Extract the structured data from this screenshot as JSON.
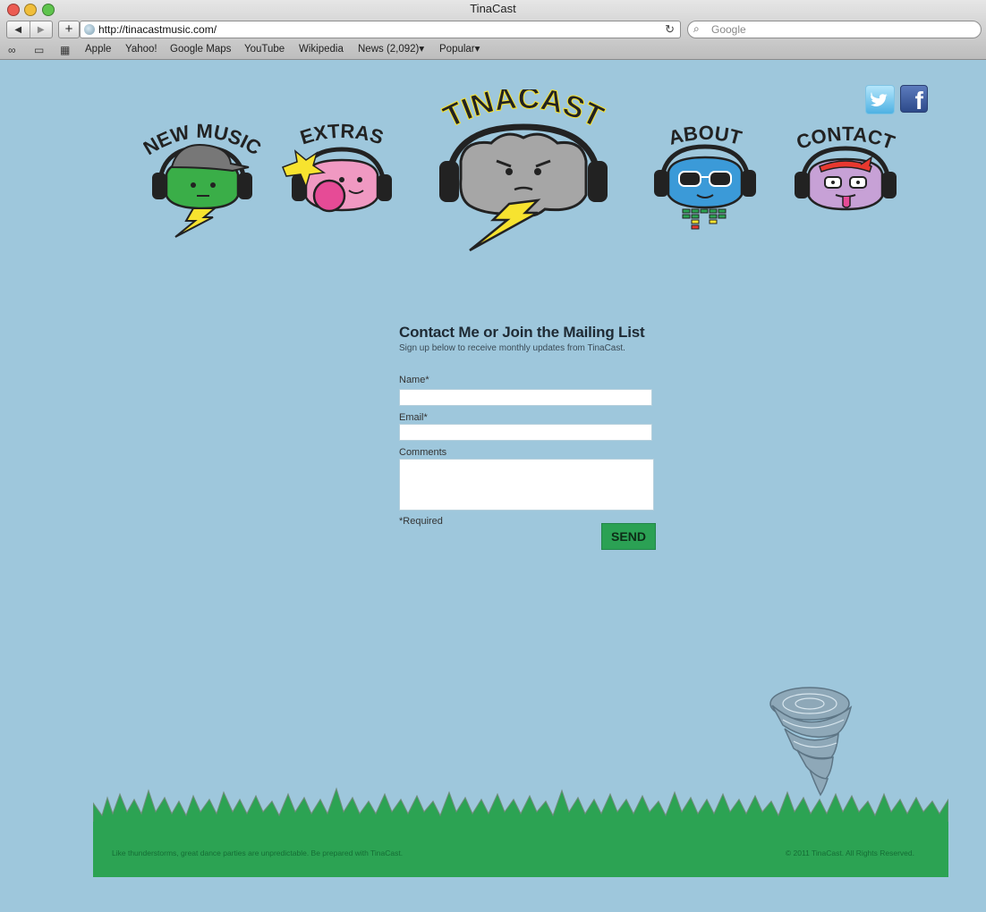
{
  "browser": {
    "title": "TinaCast",
    "url": "http://tinacastmusic.com/",
    "search_placeholder": "Google",
    "bookmarks": [
      "Apple",
      "Yahoo!",
      "Google Maps",
      "YouTube",
      "Wikipedia",
      "News (2,092)▾",
      "Popular▾"
    ]
  },
  "nav": {
    "new_music": "NEW MUSIC",
    "extras": "EXTRAS",
    "logo": "TINACAST",
    "about": "ABOUT",
    "contact": "CONTACT"
  },
  "social": {
    "facebook_glyph": "f"
  },
  "form": {
    "title": "Contact Me or Join the Mailing List",
    "subtitle": "Sign up below to receive monthly updates from TinaCast.",
    "name_label": "Name*",
    "email_label": "Email*",
    "comments_label": "Comments",
    "required_note": "*Required",
    "send_label": "SEND"
  },
  "footer": {
    "tagline": "Like thunderstorms, great dance parties are unpredictable. Be prepared with TinaCast.",
    "copyright": "© 2011 TinaCast. All Rights Reserved."
  },
  "colors": {
    "background": "#9ec7dc",
    "grass": "#2ca353",
    "send_button": "#2ba154",
    "new_music_face": "#3aae48",
    "extras_face": "#f099c2",
    "logo_face": "#a6a6a6",
    "about_face": "#3b9ad8",
    "contact_face": "#c7a1d6"
  }
}
